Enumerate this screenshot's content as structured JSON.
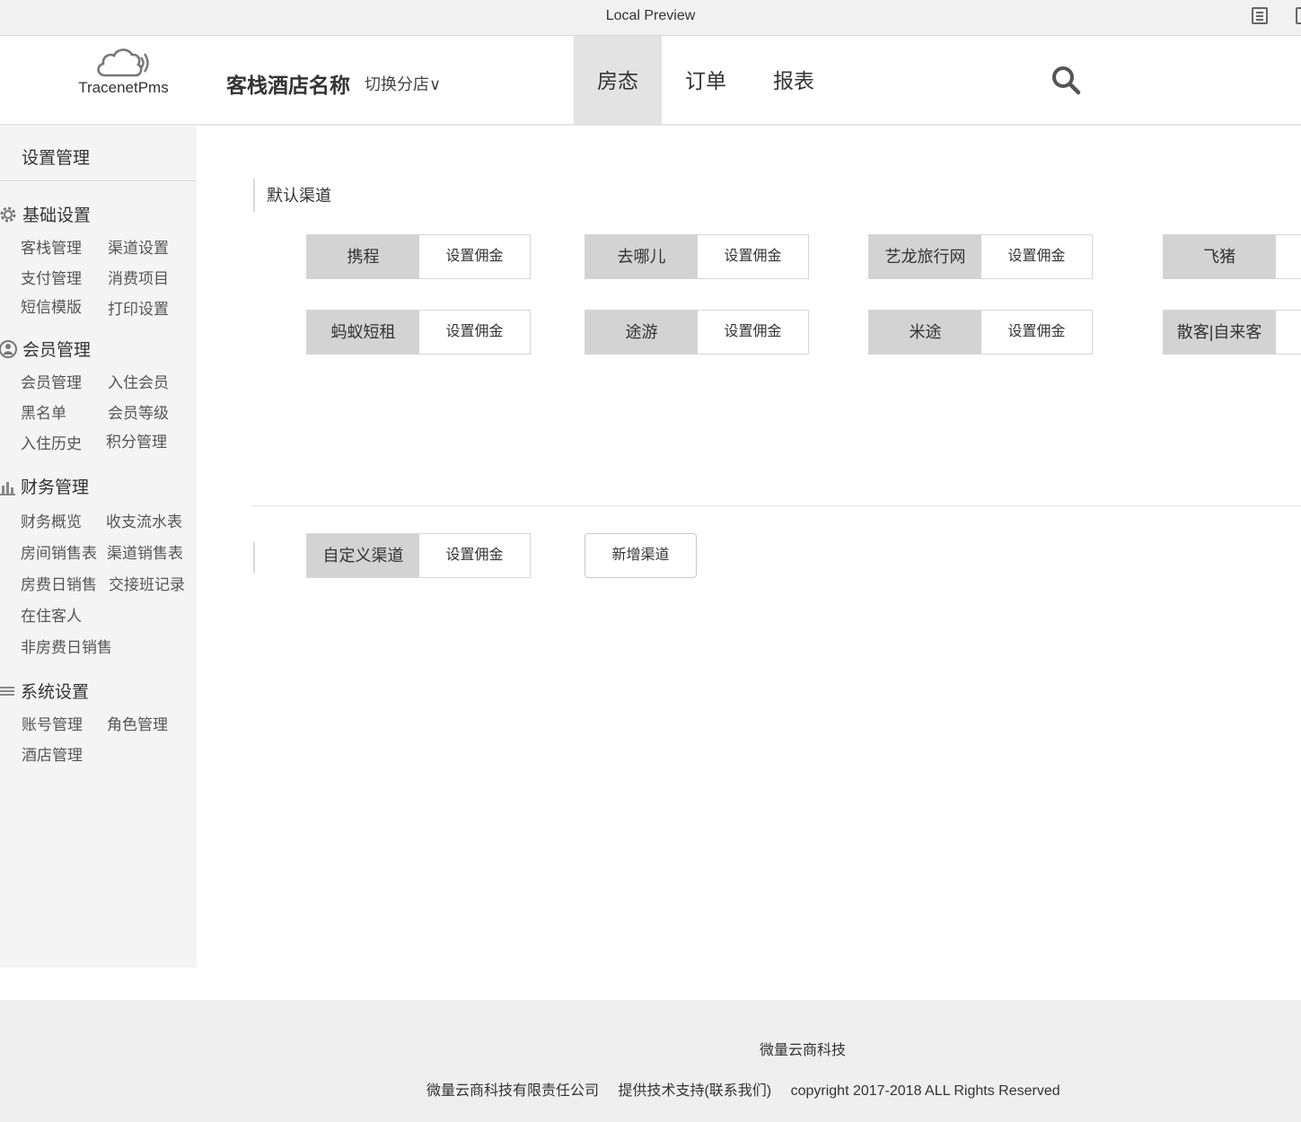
{
  "preview": {
    "title": "Local Preview"
  },
  "header": {
    "logo_text": "TracenetPms",
    "hotel_name": "客栈酒店名称",
    "switch_branch": "切换分店∨",
    "nav": [
      "房态",
      "订单",
      "报表"
    ]
  },
  "sidebar": {
    "title": "设置管理",
    "groups": [
      {
        "title": "基础设置",
        "icon": "gear-icon",
        "links": [
          "客栈管理",
          "渠道设置",
          "支付管理",
          "消费项目",
          "短信模版",
          "打印设置"
        ]
      },
      {
        "title": "会员管理",
        "icon": "member-icon",
        "links": [
          "会员管理",
          "入住会员",
          "黑名单",
          "会员等级",
          "入住历史",
          "积分管理"
        ]
      },
      {
        "title": "财务管理",
        "icon": "bar-chart-icon",
        "links": [
          "财务概览",
          "收支流水表",
          "房间销售表",
          "渠道销售表",
          "房费日销售",
          "交接班记录",
          "在住客人",
          "非房费日销售"
        ]
      },
      {
        "title": "系统设置",
        "icon": "menu-lines-icon",
        "links": [
          "账号管理",
          "角色管理",
          "酒店管理"
        ]
      }
    ]
  },
  "main": {
    "default_section": "默认渠道",
    "commission_label": "设置佣金",
    "channels": [
      "携程",
      "去哪儿",
      "艺龙旅行网",
      "飞猪",
      "蚂蚁短租",
      "途游",
      "米途",
      "散客|自来客"
    ],
    "custom_channels": [
      "自定义渠道"
    ],
    "add_channel": "新增渠道"
  },
  "footer": {
    "brand": "微量云商科技",
    "company": "微量云商科技有限责任公司",
    "support": "提供技术支持(联系我们)",
    "copyright": "copyright 2017-2018 ALL Rights Reserved"
  }
}
